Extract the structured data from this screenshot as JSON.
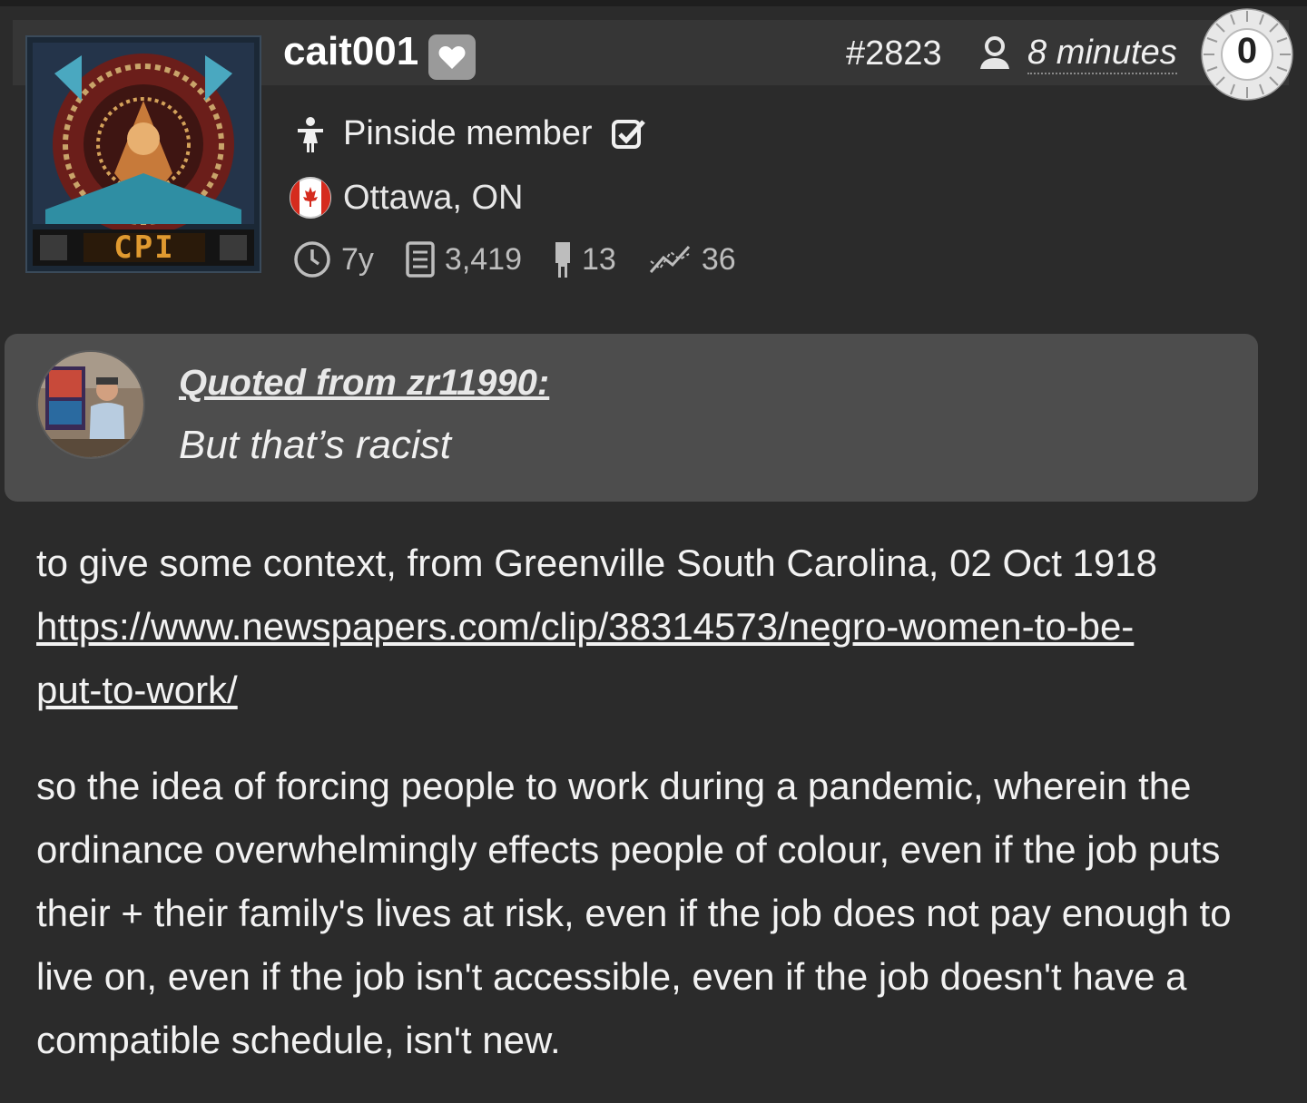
{
  "post": {
    "username": "cait001",
    "post_number": "#2823",
    "time_ago": "8 minutes",
    "score": "0",
    "member_label": "Pinside member",
    "location": "Ottawa, ON",
    "stats": {
      "age": "7y",
      "posts": "3,419",
      "machines": "13",
      "trend": "36"
    },
    "avatar_text": "CPI"
  },
  "quote": {
    "author": "Quoted from zr11990:",
    "text": "But that’s racist"
  },
  "body": {
    "intro": "to give some context, from Greenville South Carolina, 02 Oct 1918",
    "link_line1": "https://www.newspapers.com/clip/38314573/negro-women-to-be-",
    "link_line2": "put-to-work/",
    "paragraph": "so the idea of forcing people to work during a pandemic, wherein the ordinance overwhelmingly effects people of colour, even if the job puts their + their family's lives at risk, even if the job does not pay enough to live on, even if the job isn't accessible, even if the job doesn't have a compatible schedule, isn't new."
  },
  "icons": [
    "heart-icon",
    "user-icon",
    "person-icon",
    "checkbox-icon",
    "canada-flag-icon",
    "clock-icon",
    "document-icon",
    "pinball-icon",
    "trend-icon"
  ],
  "colors": {
    "background": "#2b2b2b",
    "header": "#363636",
    "quote_bg": "#4d4d4d"
  }
}
